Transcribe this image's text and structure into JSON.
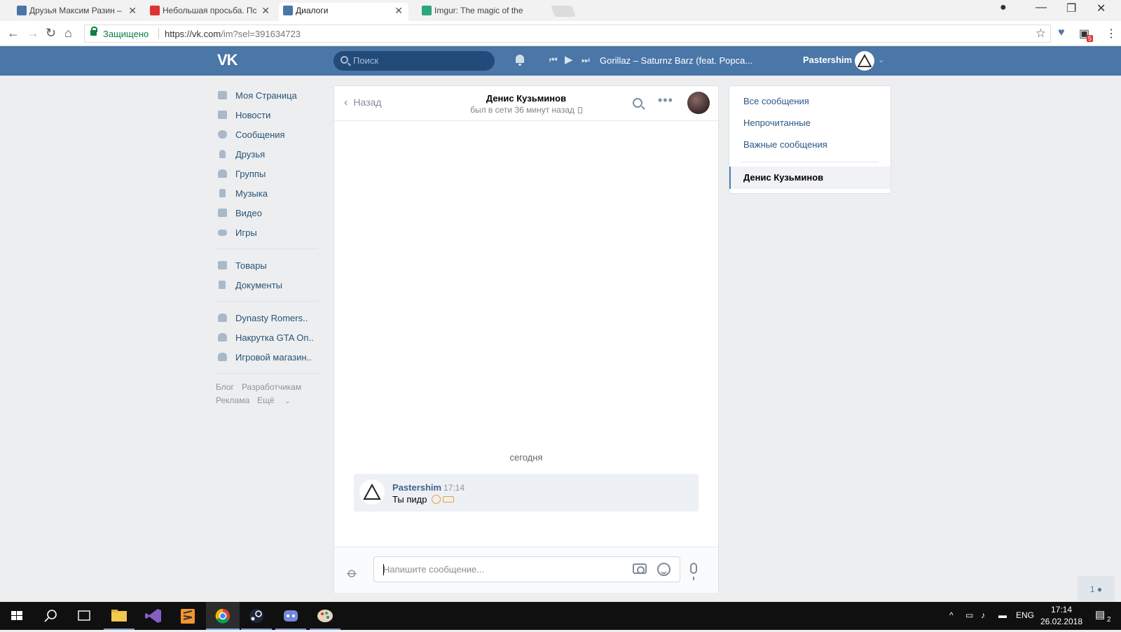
{
  "browser": {
    "tabs": [
      {
        "title": "Друзья Максим Разин –",
        "favicon_color": "#4a76a8",
        "active": false
      },
      {
        "title": "Небольшая просьба. Пс",
        "favicon_color": "#d33",
        "active": false
      },
      {
        "title": "Диалоги",
        "favicon_color": "#4a76a8",
        "active": true
      },
      {
        "title": "Imgur: The magic of the",
        "favicon_color": "#2ba67f",
        "active": false
      }
    ],
    "secure_label": "Защищено",
    "url_base": "https://vk.com",
    "url_path": "/im?sel=391634723",
    "extension_badge": "5"
  },
  "vk_header": {
    "logo": "VK",
    "search_placeholder": "Поиск",
    "now_playing": "Gorillaz – Saturnz Barz (feat. Popca...",
    "username": "Pastershim"
  },
  "left_nav": {
    "items": [
      {
        "label": "Моя Страница",
        "icon": "home-icon"
      },
      {
        "label": "Новости",
        "icon": "news-icon"
      },
      {
        "label": "Сообщения",
        "icon": "messages-icon"
      },
      {
        "label": "Друзья",
        "icon": "friends-icon"
      },
      {
        "label": "Группы",
        "icon": "groups-icon"
      },
      {
        "label": "Музыка",
        "icon": "music-icon"
      },
      {
        "label": "Видео",
        "icon": "video-icon"
      },
      {
        "label": "Игры",
        "icon": "games-icon"
      }
    ],
    "items2": [
      {
        "label": "Товары",
        "icon": "goods-icon"
      },
      {
        "label": "Документы",
        "icon": "documents-icon"
      }
    ],
    "groups": [
      {
        "label": "Dynasty Romers..",
        "icon": "group-icon"
      },
      {
        "label": "Накрутка GTA On..",
        "icon": "group-icon"
      },
      {
        "label": "Игровой магазин..",
        "icon": "group-icon"
      }
    ],
    "footer": [
      "Блог",
      "Разработчикам",
      "Реклама",
      "Ещё"
    ]
  },
  "chat": {
    "back_label": "Назад",
    "contact_name": "Денис Кузьминов",
    "contact_status": "был в сети 36 минут назад",
    "date_divider": "сегодня",
    "messages": [
      {
        "author": "Pastershim",
        "time": "17:14",
        "text": "Ты пидр"
      }
    ],
    "input_placeholder": "Напишите сообщение..."
  },
  "right_menu": {
    "items": [
      "Все сообщения",
      "Непрочитанные",
      "Важные сообщения"
    ],
    "active": "Денис Кузьминов"
  },
  "chat_float_count": "1",
  "taskbar": {
    "language": "ENG",
    "time": "17:14",
    "date": "26.02.2018",
    "notifications": "2"
  }
}
